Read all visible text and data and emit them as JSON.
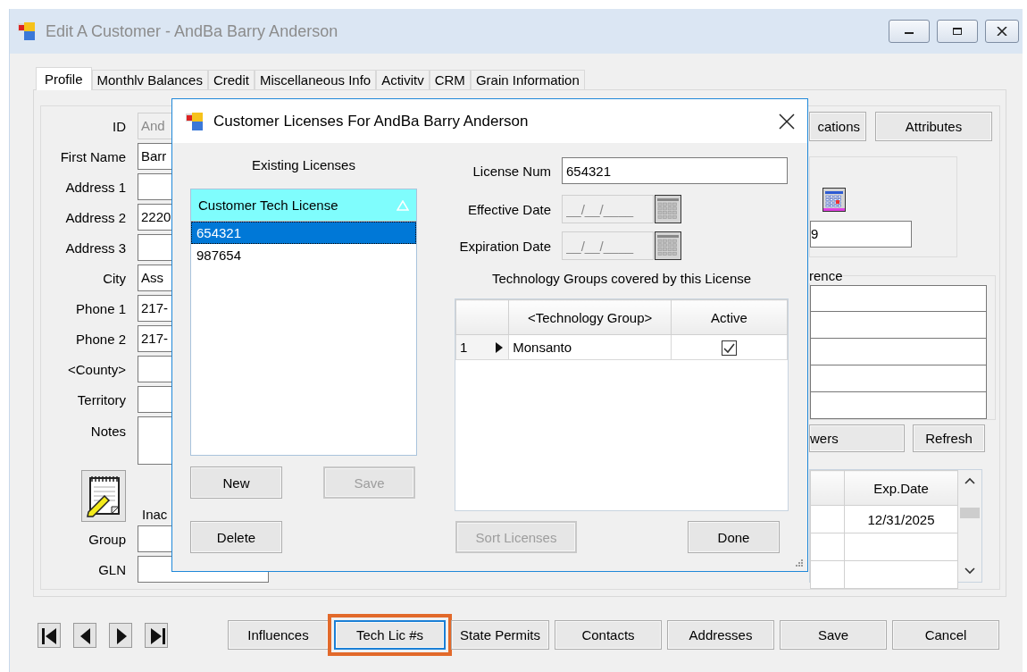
{
  "window": {
    "title": "Edit A Customer - AndBa Barry Anderson"
  },
  "tabs": [
    {
      "label": "Profile",
      "selected": true
    },
    {
      "label": "Monthlv Balances",
      "selected": false
    },
    {
      "label": "Credit",
      "selected": false
    },
    {
      "label": "Miscellaneous Info",
      "selected": false
    },
    {
      "label": "Activitv",
      "selected": false
    },
    {
      "label": "CRM",
      "selected": false
    },
    {
      "label": "Grain Information",
      "selected": false
    }
  ],
  "profile": {
    "fields": [
      {
        "kind": "text",
        "label": "ID",
        "value": "And",
        "disabled": true
      },
      {
        "kind": "text",
        "label": "First Name",
        "value": "Barr",
        "disabled": false
      },
      {
        "kind": "text",
        "label": "Address 1",
        "disabled": false
      },
      {
        "kind": "text",
        "label": "Address 2",
        "value": "2220",
        "disabled": false
      },
      {
        "kind": "text",
        "label": "Address 3",
        "disabled": false
      },
      {
        "kind": "text",
        "label": "City",
        "value": "Ass",
        "disabled": false
      },
      {
        "kind": "text",
        "label": "Phone 1",
        "value": "217-",
        "disabled": false
      },
      {
        "kind": "text",
        "label": "Phone 2",
        "value": "217-",
        "disabled": false
      },
      {
        "kind": "text",
        "label": "<County>",
        "disabled": false
      },
      {
        "kind": "text",
        "label": "Territory",
        "disabled": false
      },
      {
        "kind": "notes",
        "label": "Notes",
        "disabled": false
      },
      {
        "kind": "inactive",
        "label": "Inac",
        "disabled": false
      },
      {
        "kind": "text",
        "label": "Group",
        "disabled": false
      },
      {
        "kind": "text",
        "label": "GLN",
        "disabled": false
      }
    ]
  },
  "side": {
    "buttons": [
      "cations",
      "Attributes"
    ],
    "date_value": "9",
    "reference_title": "rence",
    "buttons_2": [
      "wers",
      "Refresh"
    ],
    "grid": {
      "columns": [
        "Exp.Date"
      ],
      "rows": [
        {
          "exp_date": "12/31/2025"
        }
      ]
    }
  },
  "bottom": {
    "buttons": [
      {
        "label": "Influences",
        "highlighted": false,
        "focused": false
      },
      {
        "label": "Tech Lic #s",
        "highlighted": true,
        "focused": true
      },
      {
        "label": "State Permits",
        "highlighted": false,
        "focused": false
      },
      {
        "label": "Contacts",
        "highlighted": false,
        "focused": false
      },
      {
        "label": "Addresses",
        "highlighted": false,
        "focused": false
      },
      {
        "label": "Save",
        "highlighted": false,
        "focused": false
      },
      {
        "label": "Cancel",
        "highlighted": false,
        "focused": false
      }
    ]
  },
  "dialog": {
    "title": "Customer Licenses For AndBa Barry Anderson",
    "licenses": {
      "heading": "Existing Licenses",
      "column": "Customer Tech License",
      "items": [
        {
          "label": "654321",
          "selected": true
        },
        {
          "label": "987654",
          "selected": false
        }
      ]
    },
    "buttons": [
      {
        "label": "New",
        "disabled": false
      },
      {
        "label": "Save",
        "disabled": true
      },
      {
        "label": "Delete",
        "disabled": false
      }
    ],
    "license_num": {
      "label": "License Num",
      "value": "654321"
    },
    "dates": [
      {
        "label": "Effective Date",
        "placeholder": "__/__/____",
        "disabled": true
      },
      {
        "label": "Expiration Date",
        "placeholder": "__/__/____",
        "disabled": true
      }
    ],
    "groups": {
      "heading": "Technology Groups covered by this License",
      "columns": [
        "<Technology Group>",
        "Active"
      ],
      "rows": [
        {
          "row_number": "1",
          "current": true,
          "group": "Monsanto",
          "active": true
        }
      ]
    },
    "sort_button": {
      "label": "Sort Licenses",
      "disabled": true
    },
    "done_button": {
      "label": "Done",
      "disabled": false
    }
  }
}
